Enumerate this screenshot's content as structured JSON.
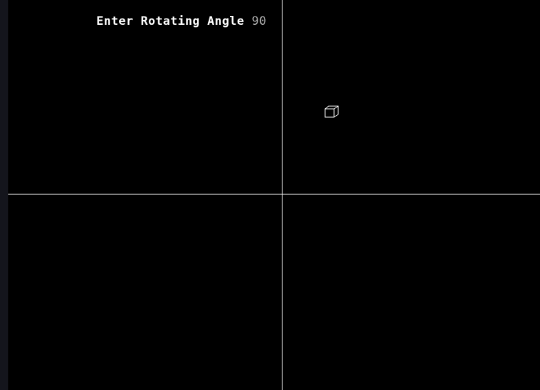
{
  "prompt": {
    "label": "Enter Rotating Angle",
    "value": "90"
  },
  "colors": {
    "background": "#000000",
    "axis": "#ffffff",
    "shape": "#ffffff",
    "input_text": "#b8b8b8"
  },
  "icons": {
    "shape": "cube-icon"
  }
}
